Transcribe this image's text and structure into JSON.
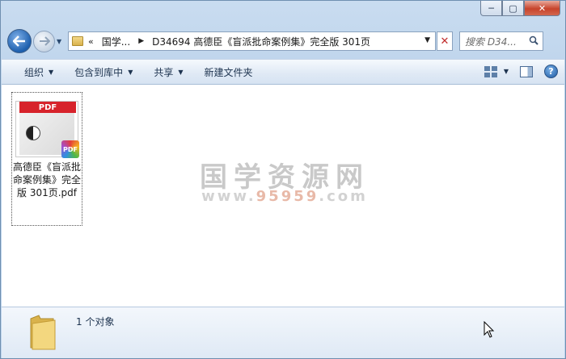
{
  "window": {
    "caption_buttons": {
      "minimize": "─",
      "maximize": "▢",
      "close": "✕"
    }
  },
  "navbar": {
    "address_chevron": "«",
    "breadcrumbs": [
      "国学...",
      "D34694 高德臣《盲派批命案例集》完全版 301页"
    ],
    "refresh_symbol": "✕",
    "search_placeholder": "搜索 D34..."
  },
  "toolbar": {
    "items": [
      {
        "label": "组织",
        "has_dropdown": true
      },
      {
        "label": "包含到库中",
        "has_dropdown": true
      },
      {
        "label": "共享",
        "has_dropdown": true
      },
      {
        "label": "新建文件夹",
        "has_dropdown": false
      }
    ],
    "help_symbol": "?"
  },
  "content": {
    "files": [
      {
        "name": "高德臣《盲派批命案例集》完全版 301页.pdf",
        "thumb_header": "PDF",
        "badge": "PDF",
        "icon": "pdf-file-icon"
      }
    ],
    "watermark": {
      "title": "国学资源网",
      "url_prefix": "www.",
      "url_highlight": "95959",
      "url_suffix": ".com"
    }
  },
  "details": {
    "count_text": "1 个对象"
  },
  "colors": {
    "accent": "#1d5fae",
    "pdf_red": "#d7232b",
    "text": "#1e3450"
  }
}
